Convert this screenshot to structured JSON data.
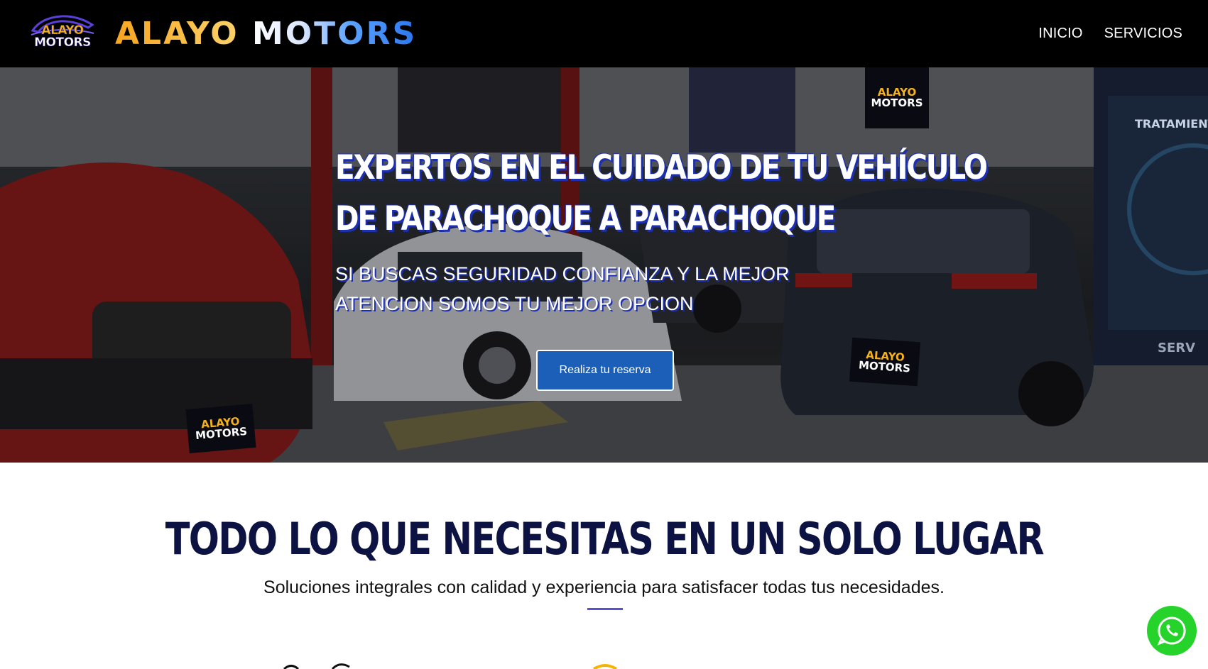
{
  "brand": {
    "logo_line1": "ALAYO",
    "logo_line2": "MOTORS",
    "name_part1": "ALAYO",
    "name_part2": "MOTORS"
  },
  "nav": {
    "items": [
      {
        "label": "INICIO"
      },
      {
        "label": "SERVICIOS"
      }
    ]
  },
  "hero": {
    "title_line1": "EXPERTOS EN EL CUIDADO DE TU VEHÍCULO",
    "title_line2": "DE PARACHOQUE A PARACHOQUE",
    "subtitle": "SI BUSCAS SEGURIDAD CONFIANZA Y LA MEJOR ATENCION SOMOS TU MEJOR OPCION",
    "cta_label": "Realiza tu reserva",
    "overlay_logo_line1": "ALAYO",
    "overlay_logo_line2": "MOTORS",
    "signage": "TRATAMIENTO DE PINTURA",
    "signage_bottom": "SERV"
  },
  "section": {
    "title": "TODO LO QUE NECESITAS EN UN SOLO LUGAR",
    "subtitle": "Soluciones integrales con calidad y experiencia para satisfacer todas tus necesidades."
  },
  "colors": {
    "navbar_bg": "#000000",
    "brand_orange": "#f7a520",
    "brand_blue": "#2b76ee",
    "cta_bg": "#1c5fb8",
    "section_title": "#0c1242",
    "divider": "#5a50d6",
    "whatsapp_green": "#25d32b"
  },
  "icons": {
    "whatsapp": "whatsapp-icon"
  }
}
